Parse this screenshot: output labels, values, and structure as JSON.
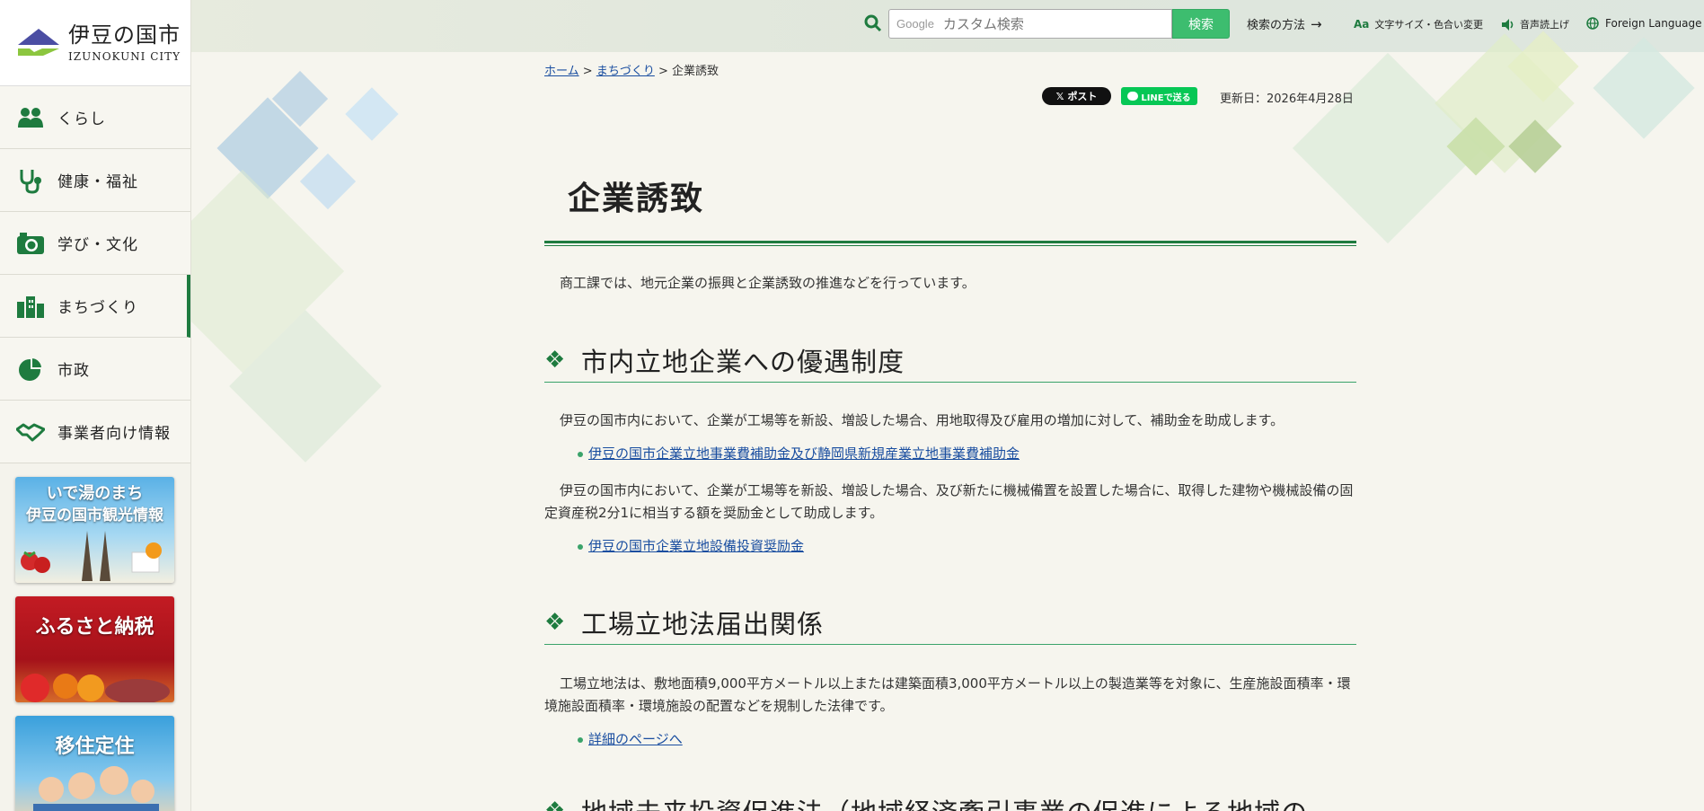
{
  "site": {
    "logo_jp": "伊豆の国市",
    "logo_en": "Izunokuni City"
  },
  "search": {
    "provider_label": "Google",
    "placeholder": "カスタム検索",
    "button_label": "検索"
  },
  "header_links": {
    "search_help": "検索の方法",
    "text_size": "文字サイズ・色合い変更",
    "read_aloud": "音声読上げ",
    "foreign_language": "Foreign Language"
  },
  "sidebar": {
    "items": [
      {
        "label": "くらし",
        "icon": "people-icon"
      },
      {
        "label": "健康・福祉",
        "icon": "stethoscope-icon"
      },
      {
        "label": "学び・文化",
        "icon": "camera-icon"
      },
      {
        "label": "まちづくり",
        "icon": "buildings-icon",
        "active": true
      },
      {
        "label": "市政",
        "icon": "pie-chart-icon"
      },
      {
        "label": "事業者向け情報",
        "icon": "handshake-icon"
      }
    ],
    "banners": [
      {
        "line1": "いで湯のまち",
        "line2": "伊豆の国市観光情報"
      },
      {
        "line1": "ふるさと納税"
      },
      {
        "line1": "移住定住"
      }
    ]
  },
  "breadcrumb": {
    "home": "ホーム",
    "sep1": ">",
    "machidukuri": "まちづくり",
    "sep2": ">",
    "current": "企業誘致"
  },
  "share": {
    "x_label": "ポスト",
    "line_label": "LINEで送る"
  },
  "updated": "更新日：2026年4月28日",
  "page": {
    "title": "企業誘致",
    "intro": "商工課では、地元企業の振興と企業誘致の推進などを行っています。",
    "sections": [
      {
        "heading": "市内立地企業への優遇制度",
        "para1": "伊豆の国市内において、企業が工場等を新設、増設した場合、用地取得及び雇用の増加に対して、補助金を助成します。",
        "link1": "伊豆の国市企業立地事業費補助金及び静岡県新規産業立地事業費補助金",
        "para2": "伊豆の国市内において、企業が工場等を新設、増設した場合、及び新たに機械備置を設置した場合に、取得した建物や機械設備の固定資産税2分1に相当する額を奨励金として助成します。",
        "link2": "伊豆の国市企業立地設備投資奨励金"
      },
      {
        "heading": "工場立地法届出関係",
        "para1": "工場立地法は、敷地面積9,000平方メートル以上または建築面積3,000平方メートル以上の製造業等を対象に、生産施設面積率・環境施設面積率・環境施設の配置などを規制した法律です。",
        "link1": "詳細のページへ"
      },
      {
        "heading": "地域未来投資促進法（地域経済牽引事業の促進による地域の"
      }
    ]
  },
  "colors": {
    "accent": "#1e7b3f",
    "search_button": "#3dbd6f",
    "link": "#1a4ea0"
  }
}
